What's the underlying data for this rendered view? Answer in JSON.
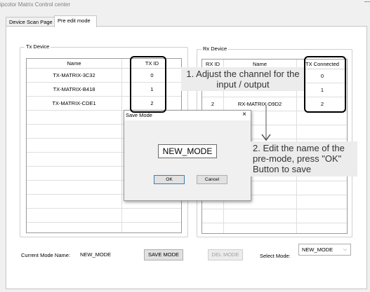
{
  "window": {
    "title": "ipcolor Matrix Control center"
  },
  "tabs": [
    {
      "label": "Device Scan Page",
      "active": false
    },
    {
      "label": "Pre edit mode",
      "active": true
    }
  ],
  "tx_device": {
    "group_label": "Tx Device",
    "columns": [
      "Name",
      "TX ID"
    ],
    "rows": [
      {
        "name": "TX-MATRIX-3C32",
        "id": "0"
      },
      {
        "name": "TX-MATRIX-B418",
        "id": "1"
      },
      {
        "name": "TX-MATRIX-CDE1",
        "id": "2"
      }
    ]
  },
  "rx_device": {
    "group_label": "Rx Device",
    "columns": [
      "RX ID",
      "Name",
      "TX Connected"
    ],
    "rows": [
      {
        "rx_id": "",
        "name": "",
        "tx_connected": "0"
      },
      {
        "rx_id": "",
        "name": "",
        "tx_connected": "1"
      },
      {
        "rx_id": "2",
        "name": "RX-MATRIX-D9D2",
        "tx_connected": "2"
      }
    ]
  },
  "dialog": {
    "title": "Save Mode",
    "close_glyph": "×",
    "input_value": "NEW_MODE",
    "ok_label": "OK",
    "cancel_label": "Cancel"
  },
  "callouts": {
    "step1": "1. Adjust the channel for the input / output",
    "step2": "2. Edit the name of the pre-mode, press \"OK\" Button to save"
  },
  "footer": {
    "current_mode_label": "Current Mode Name:",
    "current_mode_value": "NEW_MODE",
    "save_button": "SAVE MODE",
    "del_button": "DEL MODE",
    "select_label": "Select Mode:",
    "select_value": "NEW_MODE",
    "chevron_glyph": "⌵"
  },
  "colors": {
    "accent_border": "#3c7fb1",
    "callout_bg": "#ececec",
    "disabled_text": "#a0a0a0"
  }
}
